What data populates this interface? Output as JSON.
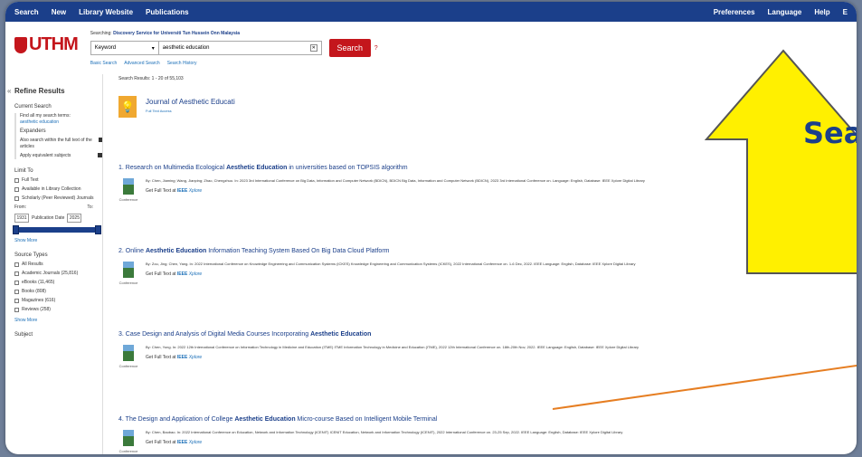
{
  "topbar": {
    "left": [
      "Search",
      "New",
      "Library Website",
      "Publications"
    ],
    "right": [
      "Preferences",
      "Language",
      "Help",
      "E"
    ]
  },
  "logo": "UTHM",
  "search": {
    "searching_prefix": "Searching:",
    "searching_target": "Discovery Service for Universiti Tun Hussein Onn Malaysia",
    "field": "Keyword",
    "query": "aesthetic education",
    "button": "Search",
    "help": "?",
    "links": [
      "Basic Search",
      "Advanced Search",
      "Search History"
    ]
  },
  "sidebar": {
    "title": "Refine Results",
    "current": "Current Search",
    "find_all": "Find all my search terms:",
    "keyword": "aesthetic education",
    "expanders": "Expanders",
    "expand1": "Also search within the full text of the articles",
    "expand2": "Apply equivalent subjects",
    "limit": "Limit To",
    "fulltext": "Full Text",
    "library": "Available in Library Collection",
    "scholarly": "Scholarly (Peer Reviewed) Journals",
    "from": "From:",
    "to": "To:",
    "from_val": "1931",
    "to_val": "2025",
    "pubdate": "Publication Date",
    "showmore": "Show More",
    "source": "Source Types",
    "src": [
      "All Results",
      "Academic Journals (25,816)",
      "eBooks (11,465)",
      "Books (808)",
      "Magazines (616)",
      "Reviews (258)"
    ],
    "showmore2": "Show More",
    "subject": "Subject"
  },
  "main": {
    "results": "Search Results: 1 - 20 of 55,103",
    "pub_title": "Journal of Aesthetic Educati",
    "pub_ft": "Full Text Access",
    "results_list": [
      {
        "n": "1.",
        "pre": "Research on Multimedia Ecological ",
        "b": "Aesthetic Education",
        "post": " in universities based on TOPSIS algorithm",
        "meta": "By: Chen, Jiaming; Wang, Jianping; Zhao, Chengzhuo. In: 2023 3rd International Conference on Big Data, Information and Computer Network (BDICN), BDICN Big Data, Information and Computer Network (BDICN), 2023 3rd International Conference on. Language: English, Database: IEEE Xplore Digital Library"
      },
      {
        "n": "2.",
        "pre": "Online ",
        "b": "Aesthetic Education",
        "post": " Information Teaching System Based On Big Data Cloud Platform",
        "meta": "By: Zou, Jing; Chen, Yang. In: 2022 International Conference on Knowledge Engineering and Communication Systems (ICKES) Knowledge Engineering and Communication Systems (ICKES), 2022 International Conference on. 1-6 Dec, 2022. IEEE Language: English, Database: IEEE Xplore Digital Library"
      },
      {
        "n": "3.",
        "pre": "Case Design and Analysis of Digital Media Courses Incorporating ",
        "b": "Aesthetic Education",
        "post": "",
        "meta": "By: Chen, Yong. In: 2022 12th International Conference on Information Technology in Medicine and Education (ITME) ITME Information Technology in Medicine and Education (ITME), 2022 12th International Conference on. 18th-20th Nov, 2022. IEEE Language: English, Database: IEEE Xplore Digital Library"
      },
      {
        "n": "4.",
        "pre": "The Design and Application of College ",
        "b": "Aesthetic Education",
        "post": " Micro-course Based on Intelligent Mobile Terminal",
        "meta": "By: Chen, Baobao. In: 2022 International Conference on Education, Network and Information Technology (ICENIT) ICENIT Education, Network and Information Technology (ICENIT), 2022 International Conference on. 23-25 Sep, 2022. IEEE Language: English, Database: IEEE Xplore Digital Library"
      }
    ],
    "type_label": "Conference",
    "ieee_pre": "Get Full Text at ",
    "ieee_b": "IEEE",
    "ieee_i": "Xplore"
  },
  "overlay": {
    "text": "Sea"
  }
}
